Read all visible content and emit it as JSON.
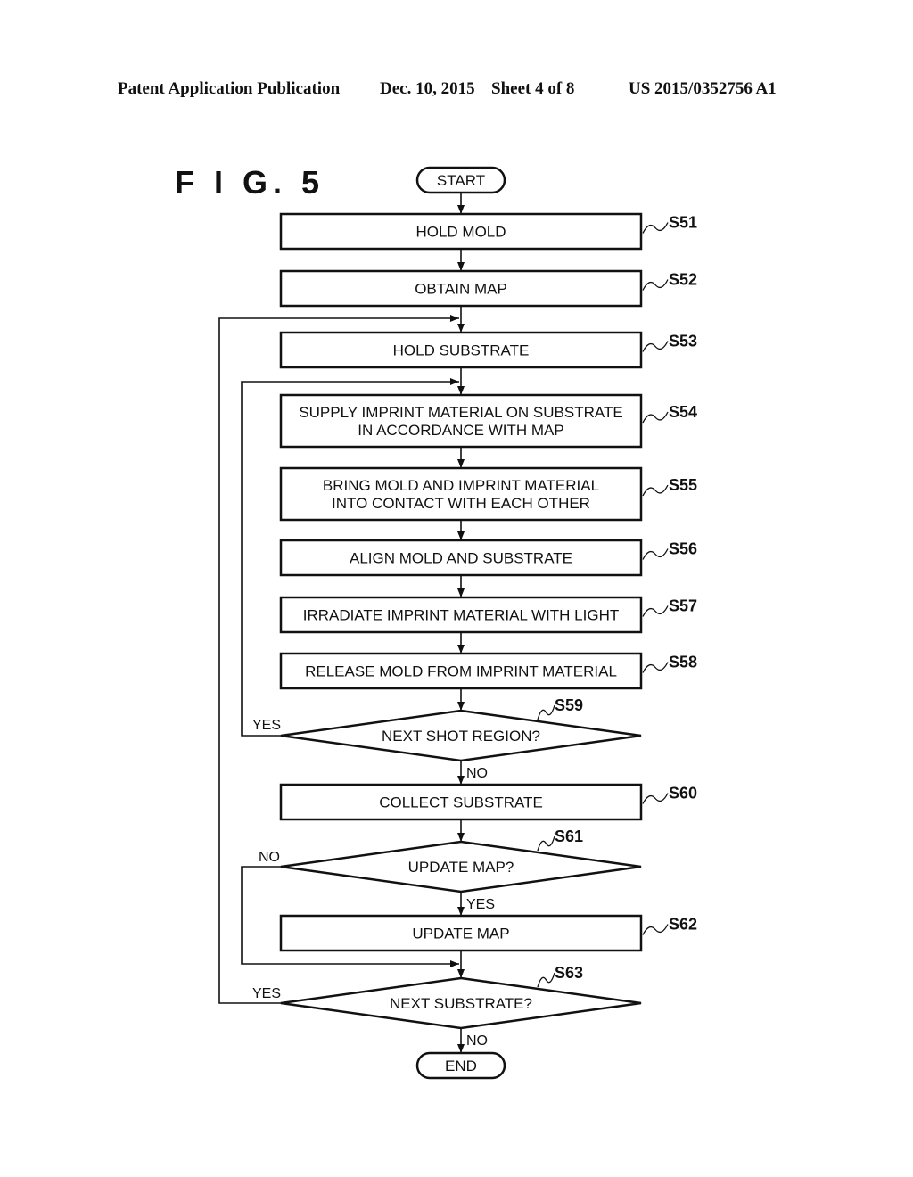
{
  "header": {
    "publication": "Patent Application Publication",
    "date": "Dec. 10, 2015",
    "sheet": "Sheet 4 of 8",
    "number": "US 2015/0352756 A1"
  },
  "figure": {
    "title": "F I G. 5"
  },
  "flowchart": {
    "start": "START",
    "end": "END",
    "steps": [
      {
        "id": "S51",
        "lines": [
          "HOLD MOLD"
        ]
      },
      {
        "id": "S52",
        "lines": [
          "OBTAIN MAP"
        ]
      },
      {
        "id": "S53",
        "lines": [
          "HOLD SUBSTRATE"
        ]
      },
      {
        "id": "S54",
        "lines": [
          "SUPPLY IMPRINT MATERIAL ON SUBSTRATE",
          "IN ACCORDANCE WITH MAP"
        ]
      },
      {
        "id": "S55",
        "lines": [
          "BRING MOLD AND IMPRINT MATERIAL",
          "INTO CONTACT WITH EACH OTHER"
        ]
      },
      {
        "id": "S56",
        "lines": [
          "ALIGN MOLD AND SUBSTRATE"
        ]
      },
      {
        "id": "S57",
        "lines": [
          "IRRADIATE IMPRINT MATERIAL WITH LIGHT"
        ]
      },
      {
        "id": "S58",
        "lines": [
          "RELEASE MOLD FROM IMPRINT MATERIAL"
        ]
      },
      {
        "id": "S60",
        "lines": [
          "COLLECT SUBSTRATE"
        ]
      },
      {
        "id": "S62",
        "lines": [
          "UPDATE MAP"
        ]
      }
    ],
    "decisions": [
      {
        "id": "S59",
        "text": "NEXT SHOT REGION?",
        "yes": "YES",
        "no": "NO"
      },
      {
        "id": "S61",
        "text": "UPDATE MAP?",
        "yes": "YES",
        "no": "NO"
      },
      {
        "id": "S63",
        "text": "NEXT SUBSTRATE?",
        "yes": "YES",
        "no": "NO"
      }
    ]
  }
}
